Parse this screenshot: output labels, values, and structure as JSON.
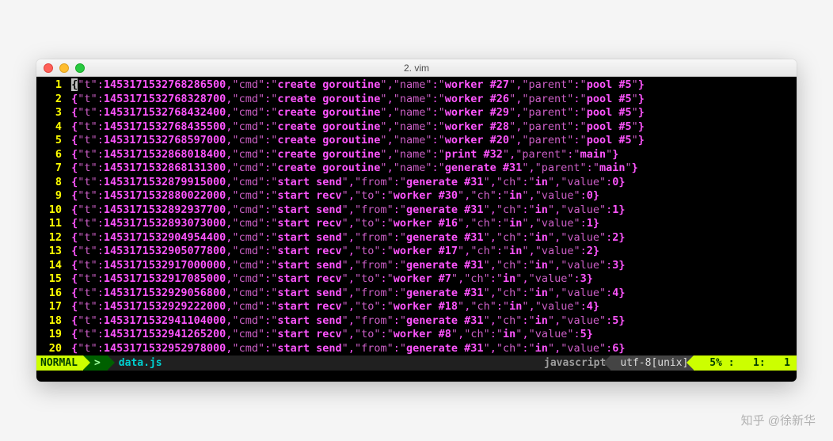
{
  "window": {
    "title": "2. vim"
  },
  "watermark": "知乎 @徐新华",
  "status": {
    "mode": "NORMAL",
    "branch_icon": ">",
    "filename": "data.js",
    "filetype": "javascript",
    "encoding": "utf-8[unix]",
    "percent": "5%",
    "line": "1",
    "col": "1"
  },
  "rows": [
    {
      "n": 1,
      "obj": {
        "t": 1453171532768286484,
        "cmd": "create goroutine",
        "name": "worker #27",
        "parent": "pool #5"
      }
    },
    {
      "n": 2,
      "obj": {
        "t": 1453171532768328577,
        "cmd": "create goroutine",
        "name": "worker #26",
        "parent": "pool #5"
      }
    },
    {
      "n": 3,
      "obj": {
        "t": 1453171532768432492,
        "cmd": "create goroutine",
        "name": "worker #29",
        "parent": "pool #5"
      }
    },
    {
      "n": 4,
      "obj": {
        "t": 1453171532768435406,
        "cmd": "create goroutine",
        "name": "worker #28",
        "parent": "pool #5"
      }
    },
    {
      "n": 5,
      "obj": {
        "t": 1453171532768596996,
        "cmd": "create goroutine",
        "name": "worker #20",
        "parent": "pool #5"
      }
    },
    {
      "n": 6,
      "obj": {
        "t": 1453171532868018479,
        "cmd": "create goroutine",
        "name": "print #32",
        "parent": "main"
      }
    },
    {
      "n": 7,
      "obj": {
        "t": 1453171532868131248,
        "cmd": "create goroutine",
        "name": "generate #31",
        "parent": "main"
      }
    },
    {
      "n": 8,
      "obj": {
        "t": 1453171532879915073,
        "cmd": "start send",
        "from": "generate #31",
        "ch": "in",
        "value": 0
      }
    },
    {
      "n": 9,
      "obj": {
        "t": 1453171532880021908,
        "cmd": "start recv",
        "to": "worker #30",
        "ch": "in",
        "value": 0
      }
    },
    {
      "n": 10,
      "obj": {
        "t": 1453171532892937700,
        "cmd": "start send",
        "from": "generate #31",
        "ch": "in",
        "value": 1
      }
    },
    {
      "n": 11,
      "obj": {
        "t": 1453171532893072787,
        "cmd": "start recv",
        "to": "worker #16",
        "ch": "in",
        "value": 1
      }
    },
    {
      "n": 12,
      "obj": {
        "t": 1453171532904954369,
        "cmd": "start send",
        "from": "generate #31",
        "ch": "in",
        "value": 2
      }
    },
    {
      "n": 13,
      "obj": {
        "t": 1453171532905077725,
        "cmd": "start recv",
        "to": "worker #17",
        "ch": "in",
        "value": 2
      }
    },
    {
      "n": 14,
      "obj": {
        "t": 1453171532916999950,
        "cmd": "start send",
        "from": "generate #31",
        "ch": "in",
        "value": 3
      }
    },
    {
      "n": 15,
      "obj": {
        "t": 1453171532917084835,
        "cmd": "start recv",
        "to": "worker #7",
        "ch": "in",
        "value": 3
      }
    },
    {
      "n": 16,
      "obj": {
        "t": 1453171532929056797,
        "cmd": "start send",
        "from": "generate #31",
        "ch": "in",
        "value": 4
      }
    },
    {
      "n": 17,
      "obj": {
        "t": 1453171532929221817,
        "cmd": "start recv",
        "to": "worker #18",
        "ch": "in",
        "value": 4
      }
    },
    {
      "n": 18,
      "obj": {
        "t": 1453171532941104211,
        "cmd": "start send",
        "from": "generate #31",
        "ch": "in",
        "value": 5
      }
    },
    {
      "n": 19,
      "obj": {
        "t": 1453171532941265219,
        "cmd": "start recv",
        "to": "worker #8",
        "ch": "in",
        "value": 5
      }
    },
    {
      "n": 20,
      "obj": {
        "t": 1453171532952977981,
        "cmd": "start send",
        "from": "generate #31",
        "ch": "in",
        "value": 6
      }
    }
  ]
}
